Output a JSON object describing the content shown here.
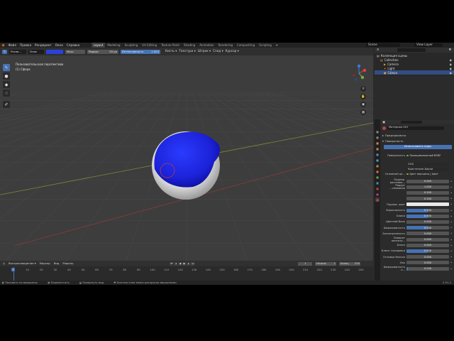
{
  "menubar": {
    "menus": [
      "Файл",
      "Правка",
      "Рендеринг",
      "Окно",
      "Справка"
    ],
    "workspaces": [
      "Layout",
      "Modeling",
      "Sculpting",
      "UV Editing",
      "Texture Paint",
      "Shading",
      "Animation",
      "Rendering",
      "Compositing",
      "Scripting"
    ],
    "active_workspace": "Layout",
    "add_tab_label": "+",
    "scene_label": "Scene",
    "view_layer_label": "View Layer"
  },
  "toolheader": {
    "mode_label": "Рисов...",
    "brush_label": "Draw",
    "color_label": "",
    "blend_label": "Микс",
    "radius_label": "Радиус",
    "radius_value": "50 px",
    "strength_label": "Интенсивность",
    "strength_value": "1.000",
    "menus": [
      "Кисть",
      "Текстура",
      "Штрих",
      "Спад",
      "Курсор"
    ]
  },
  "viewport": {
    "view_title": "Пользовательская перспектива",
    "object_label": "(1) Сфера",
    "colors": {
      "sphere": "#1e22e0",
      "sphere_rim": "#e6e6e6",
      "grid": "#474747",
      "floor": "#333333"
    }
  },
  "timeline": {
    "menus": [
      "Воспроизведение",
      "Маркер",
      "Вид",
      "Маркер"
    ],
    "current_frame": "1",
    "start_label": "Начало",
    "start_value": "1",
    "end_label": "Конец",
    "end_value": "250",
    "ticks": [
      "1",
      "10",
      "20",
      "30",
      "40",
      "50",
      "60",
      "70",
      "80",
      "90",
      "100",
      "110",
      "120",
      "130",
      "140",
      "150",
      "160",
      "170",
      "180",
      "190",
      "200",
      "210",
      "220",
      "230",
      "240",
      "250"
    ]
  },
  "statusbar": {
    "items": [
      "Рисовать на вершинах",
      "Переместить",
      "Повернуть вид",
      "Контекстное меню раскраски вершинами"
    ],
    "version": "2.91.2"
  },
  "outliner": {
    "title": "Коллекция сцены",
    "rows": [
      {
        "label": "Collection",
        "indent": 1
      },
      {
        "label": "Camera",
        "indent": 2
      },
      {
        "label": "Light",
        "indent": 2
      },
      {
        "label": "Сфера",
        "indent": 2,
        "selected": true
      }
    ]
  },
  "properties": {
    "material_name": "Материал.001",
    "preview_label": "Предпросмотр",
    "surface_panel_label": "Поверхность",
    "use_nodes_label": "Использовать ноды",
    "surface_label": "Поверхность",
    "surface_value": "Принципиальный BSDF",
    "gtx_value": "GGX",
    "subsurface_method": "Кристенсен-Берли",
    "base_color_label": "Основной цв...",
    "base_color_value": "Цвет вершины | Цвет",
    "rows": [
      {
        "label": "Подпов. рассеива...",
        "value": "0.000",
        "fill": 0
      },
      {
        "label": "Радиус ...сеивания",
        "value": "1.000",
        "fill": 0
      },
      {
        "label": "",
        "value": "0.200",
        "fill": 0
      },
      {
        "label": "",
        "value": "0.100",
        "fill": 0
      },
      {
        "label": "Подпов. цвет",
        "value": "",
        "fill": 0,
        "swatch": true
      },
      {
        "label": "Зеркальность",
        "value": "0.500",
        "fill": 0.5
      },
      {
        "label": "Блики",
        "value": "0.500",
        "fill": 0.5
      },
      {
        "label": "Цветной блик",
        "value": "0.000",
        "fill": 0
      },
      {
        "label": "Шероховатость",
        "value": "0.500",
        "fill": 0.5
      },
      {
        "label": "Анизотропность",
        "value": "0.000",
        "fill": 0
      },
      {
        "label": "Поворот анизотр...",
        "value": "0.000",
        "fill": 0
      },
      {
        "label": "Блеск",
        "value": "0.000",
        "fill": 0
      },
      {
        "label": "Блеск тонировки",
        "value": "0.500",
        "fill": 0.5
      },
      {
        "label": "Отливки блеска",
        "value": "0.000",
        "fill": 0
      },
      {
        "label": "Лак",
        "value": "0.000",
        "fill": 0
      },
      {
        "label": "Шероховатость л...",
        "value": "0.030",
        "fill": 0.03
      }
    ]
  }
}
